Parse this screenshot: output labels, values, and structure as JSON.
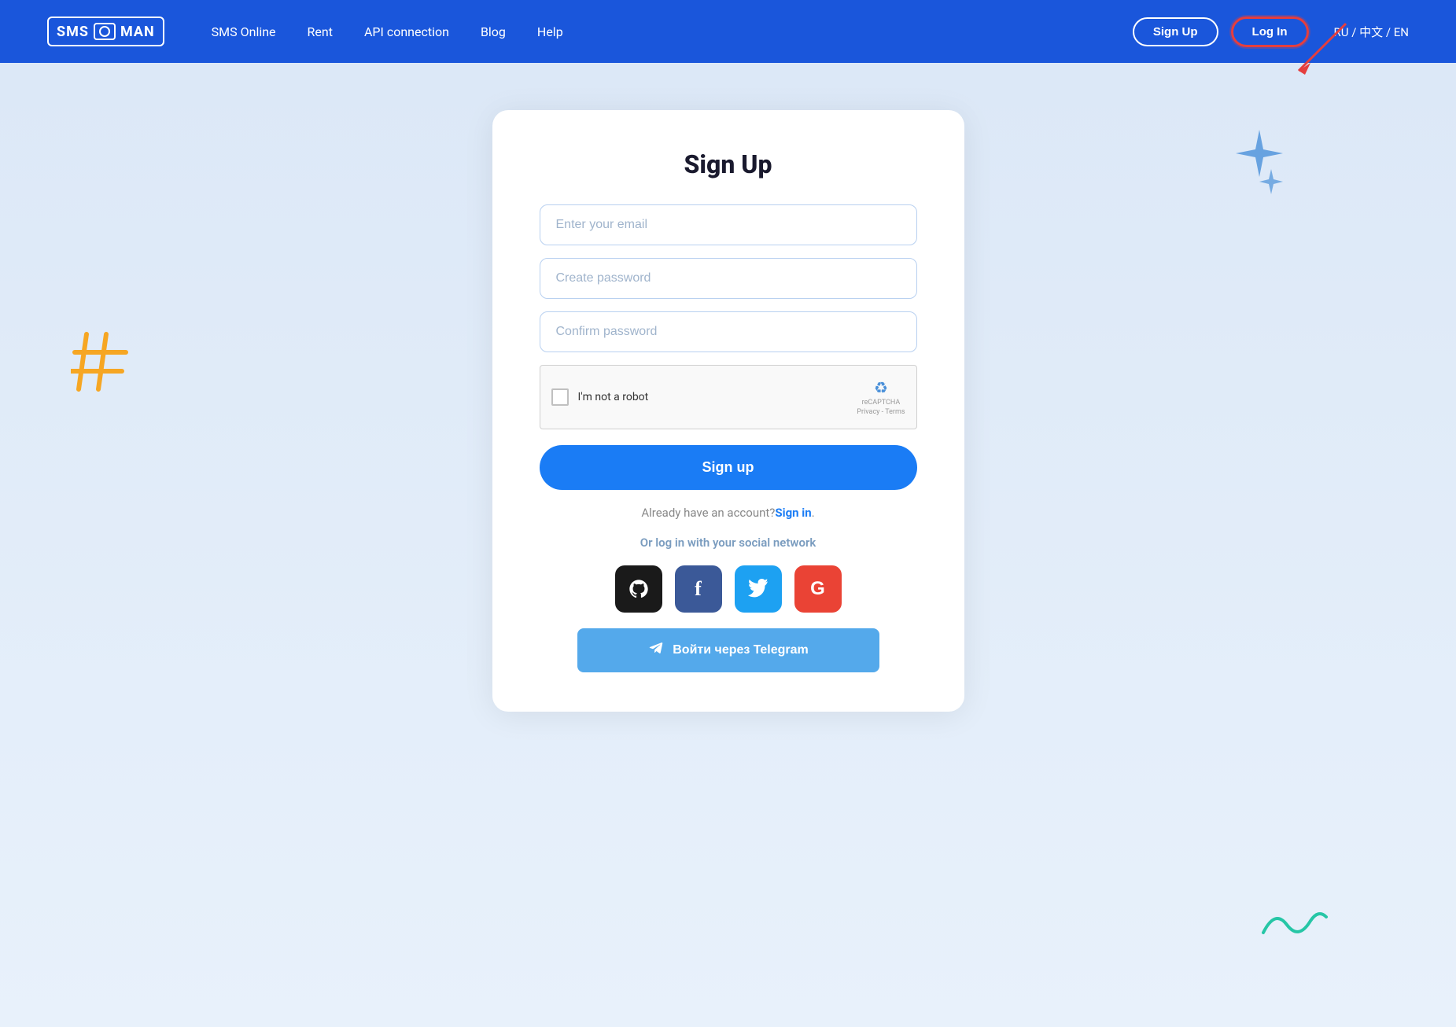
{
  "navbar": {
    "logo_text": "SMS",
    "logo_sub": "MAN",
    "nav_links": [
      {
        "label": "SMS Online"
      },
      {
        "label": "Rent"
      },
      {
        "label": "API connection"
      },
      {
        "label": "Blog"
      },
      {
        "label": "Help"
      }
    ],
    "signup_btn": "Sign Up",
    "login_btn": "Log In",
    "lang": "RU / 中文 / EN"
  },
  "form": {
    "title": "Sign Up",
    "email_placeholder": "Enter your email",
    "password_placeholder": "Create password",
    "confirm_placeholder": "Confirm password",
    "recaptcha_label": "I'm not a robot",
    "recaptcha_brand": "reCAPTCHA",
    "recaptcha_links": "Privacy - Terms",
    "signup_btn": "Sign up",
    "already_text": "Already have an account?",
    "signin_link": "Sign in",
    "signin_period": ".",
    "social_label": "Or log in with your social network",
    "telegram_btn": "Войти через Telegram"
  },
  "social": [
    {
      "name": "github",
      "icon": "⊙",
      "label": "GitHub"
    },
    {
      "name": "facebook",
      "icon": "f",
      "label": "Facebook"
    },
    {
      "name": "twitter",
      "icon": "🐦",
      "label": "Twitter"
    },
    {
      "name": "google",
      "icon": "G",
      "label": "Google"
    }
  ]
}
